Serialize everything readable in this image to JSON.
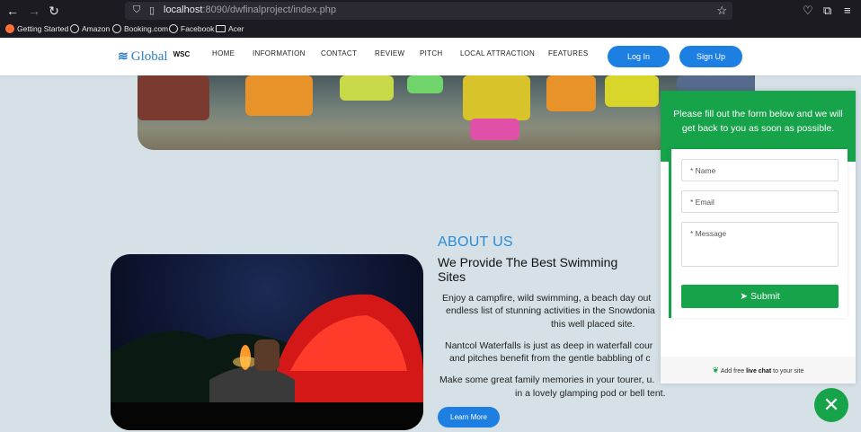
{
  "browser": {
    "url_host": "localhost",
    "url_rest": ":8090/dwfinalproject/index.php",
    "bookmarks": [
      "Getting Started",
      "Amazon",
      "Booking.com",
      "Facebook",
      "Acer"
    ]
  },
  "site": {
    "logo_text": "Global",
    "logo_suffix": "WSC",
    "nav": [
      "HOME",
      "INFORMATION",
      "CONTACT",
      "REVIEW",
      "PITCH",
      "LOCAL ATTRACTION",
      "FEATURES"
    ],
    "login_label": "Log In",
    "signup_label": "Sign Up"
  },
  "about": {
    "kicker": "ABOUT US",
    "title": "We Provide The Best Swimming Sites",
    "para1_line1": "Enjoy a campfire, wild swimming, a beach day out",
    "para1_line2": "endless list of stunning activities in the Snowdonia",
    "para1_line3": "this well placed site.",
    "para2_line1": "Nantcol Waterfalls is just as deep in waterfall cour",
    "para2_line2": "and pitches benefit from the gentle babbling of c",
    "para3_line1": "Make some great family memories in your tourer, u.",
    "para3_line2": "in a lovely glamping pod or bell tent.",
    "learn_more": "Learn More"
  },
  "chat": {
    "header": "Please fill out the form below and we will get back to you as soon as possible.",
    "name_placeholder": "* Name",
    "email_placeholder": "* Email",
    "message_placeholder": "* Message",
    "submit_label": "Submit",
    "footer_pre": "Add free",
    "footer_bold": "live chat",
    "footer_post": "to your site",
    "close_symbol": "✕"
  },
  "colors": {
    "brand_blue": "#1e7fe3",
    "chat_green": "#16a34a",
    "page_bg": "#d5e1e6"
  }
}
